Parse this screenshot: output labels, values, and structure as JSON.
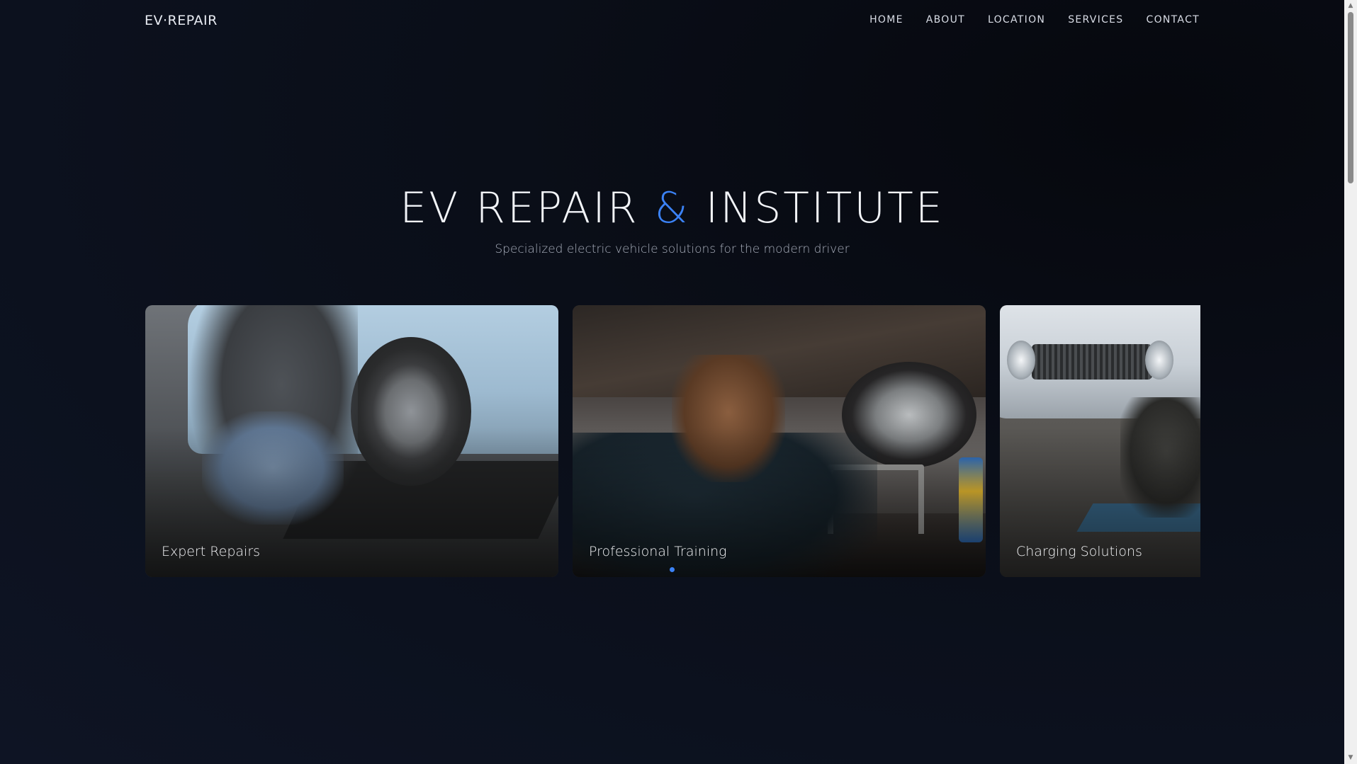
{
  "brand": {
    "logo": "EV·REPAIR"
  },
  "nav": {
    "items": [
      {
        "label": "HOME"
      },
      {
        "label": "ABOUT"
      },
      {
        "label": "LOCATION"
      },
      {
        "label": "SERVICES"
      },
      {
        "label": "CONTACT"
      }
    ]
  },
  "hero": {
    "title_part1": "EV REPAIR",
    "title_amp": "&",
    "title_part2": "INSTITUTE",
    "subtitle": "Specialized electric vehicle solutions for the modern driver"
  },
  "carousel": {
    "cards": [
      {
        "label": "Expert Repairs"
      },
      {
        "label": "Professional Training"
      },
      {
        "label": "Charging Solutions"
      }
    ],
    "active_index": 1
  },
  "colors": {
    "accent": "#3b82f6",
    "background": "#0b0f19",
    "text": "#f2f4f8"
  },
  "icons": {
    "scroll_up": "triangle-up-icon",
    "scroll_down": "triangle-down-icon"
  }
}
